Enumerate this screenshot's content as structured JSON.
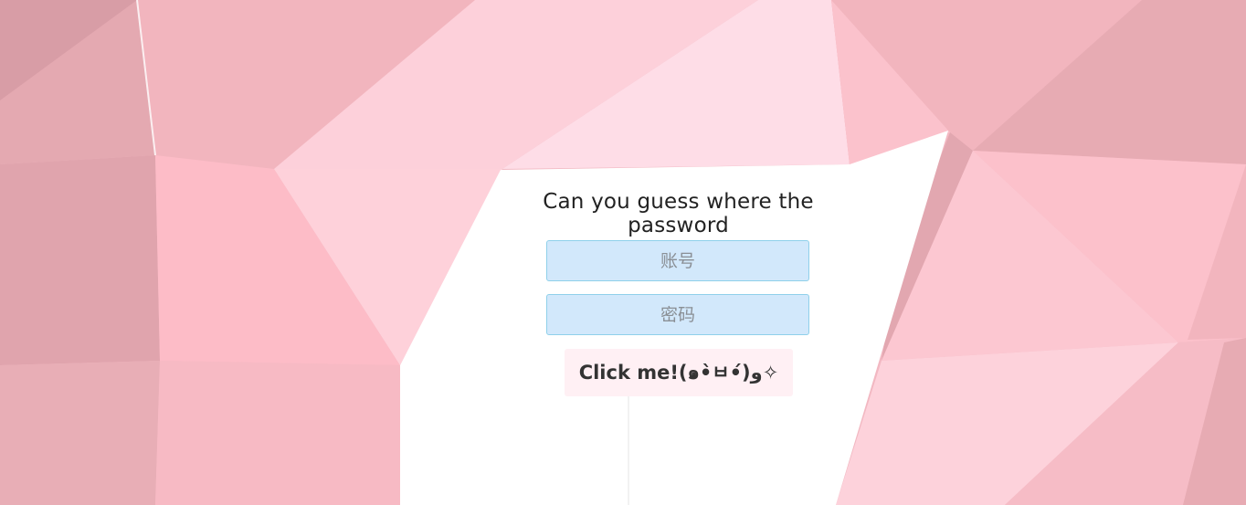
{
  "page": {
    "title": "Can you guess where the password"
  },
  "form": {
    "username_placeholder": "账号",
    "password_placeholder": "密码",
    "submit_label": "Click me!(๑•̀ㅂ•́)و✧"
  },
  "colors": {
    "input_bg": "#d2e8fb",
    "input_border": "#8fd0ea",
    "button_bg": "#fff0f4",
    "panel_bg": "#ffffff"
  }
}
